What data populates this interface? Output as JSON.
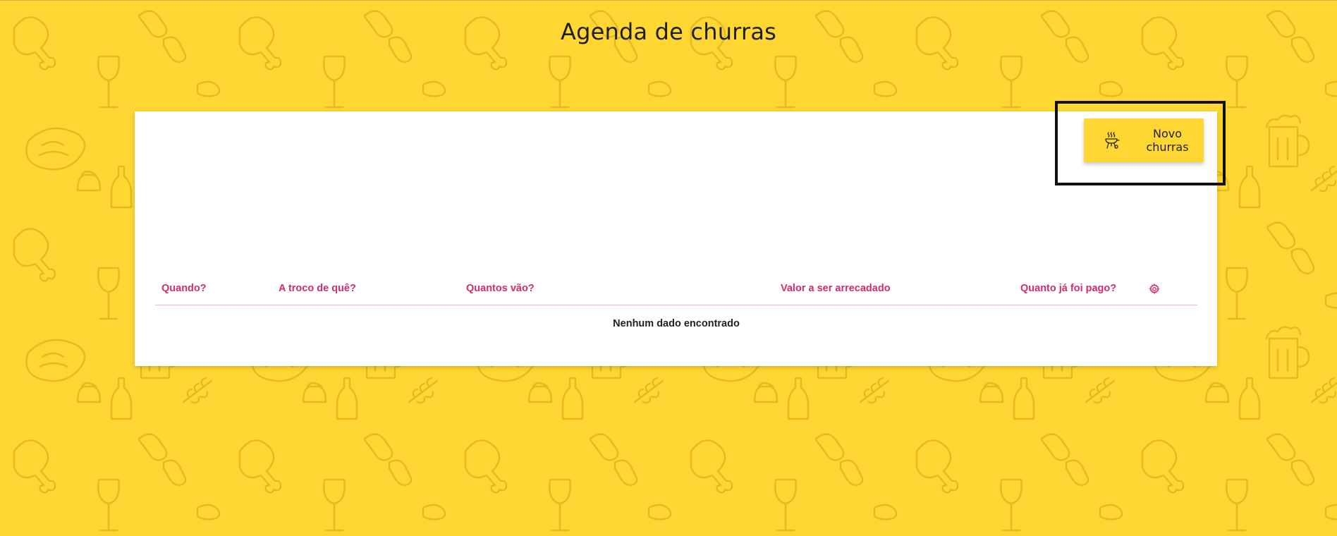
{
  "page": {
    "title": "Agenda de churras",
    "background_color": "#ffd632",
    "background_pattern": "bbq-doodle-pattern"
  },
  "toolbar": {
    "new_button_label": "Novo churras",
    "new_button_icon": "grill-icon",
    "highlighted": true
  },
  "table": {
    "columns": [
      "Quando?",
      "A troco de quê?",
      "Quantos vão?",
      "Valor a ser arrecadado",
      "Quanto já foi pago?"
    ],
    "settings_icon": "gear-icon",
    "header_color": "#d12d6e",
    "rows": [],
    "empty_message": "Nenhum dado encontrado"
  }
}
